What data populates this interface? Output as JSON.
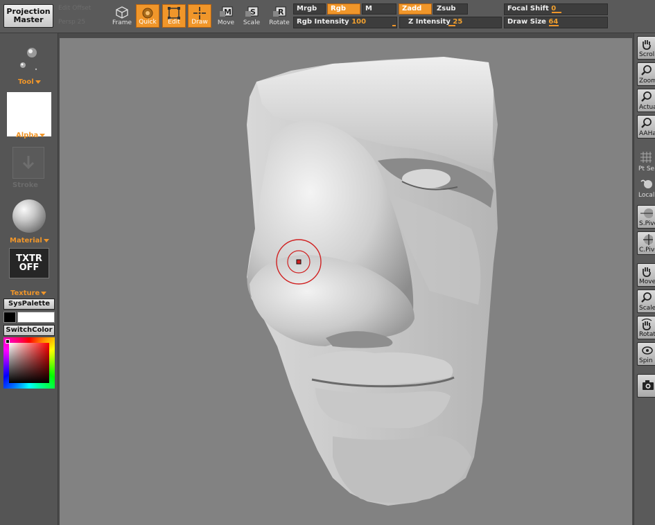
{
  "toolbar": {
    "projection_master": "Projection Master",
    "ghost_top": "Edit Offset",
    "ghost_bottom": "Persp 25",
    "frame": "Frame",
    "quick": "Quick",
    "edit": "Edit",
    "draw": "Draw",
    "move": "Move",
    "scale": "Scale",
    "rotate": "Rotate",
    "modes": {
      "mrgb": "Mrgb",
      "rgb": "Rgb",
      "m": "M",
      "zadd": "Zadd",
      "zsub": "Zsub"
    },
    "rgb_intensity_label": "Rgb Intensity",
    "rgb_intensity_value": "100",
    "z_intensity_label": "Z Intensity",
    "z_intensity_value": "25",
    "focal_shift_label": "Focal Shift",
    "focal_shift_value": "0",
    "draw_size_label": "Draw Size",
    "draw_size_value": "64",
    "accent_color": "#f0962a"
  },
  "left_panel": {
    "tool": "Tool",
    "alpha": "Alpha",
    "stroke": "Stroke",
    "material": "Material",
    "txtr_line1": "TXTR",
    "txtr_line2": "OFF",
    "texture": "Texture",
    "syspalette": "SysPalette",
    "switchcolor": "SwitchColor",
    "main_color": "#000000",
    "secondary_color": "#ffffff"
  },
  "right_panel": {
    "scroll": "Scroll",
    "zoom": "Zoom",
    "actual": "Actual",
    "aahalf": "AAHalf",
    "pt_sel": "Pt Sel",
    "local": "Local",
    "spivot": "S.Pivot",
    "cpivot": "C.Pivot",
    "move": "Move",
    "scale": "Scale",
    "rotate": "Rotate",
    "spin": "Spin"
  }
}
